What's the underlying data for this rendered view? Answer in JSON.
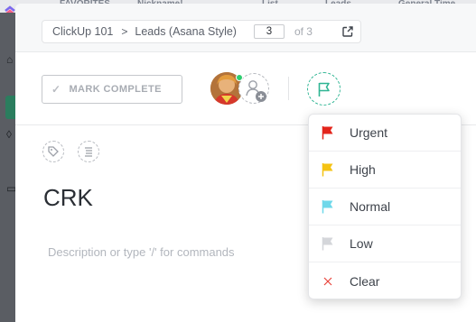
{
  "background": {
    "favorites_bar": [
      "FAVORITES",
      "Nickname!",
      "List",
      "Leads",
      "General Time"
    ]
  },
  "breadcrumb": {
    "workspace": "ClickUp 101",
    "separator": ">",
    "list": "Leads (Asana Style)",
    "current_page": "3",
    "of_total": "of 3"
  },
  "toolbar": {
    "mark_complete_label": "MARK COMPLETE"
  },
  "task": {
    "title": "CRK",
    "description_placeholder": "Description or type '/' for commands"
  },
  "priority_menu": {
    "items": [
      {
        "label": "Urgent",
        "icon": "flag-icon",
        "color": "#e3241b"
      },
      {
        "label": "High",
        "icon": "flag-icon",
        "color": "#f5c314"
      },
      {
        "label": "Normal",
        "icon": "flag-icon",
        "color": "#6fd8ea"
      },
      {
        "label": "Low",
        "icon": "flag-icon",
        "color": "#d4d6da"
      },
      {
        "label": "Clear",
        "icon": "close-icon",
        "color": "#e8433b"
      }
    ]
  },
  "colors": {
    "accent_green": "#2fb593",
    "status_online": "#2ecd6f"
  }
}
